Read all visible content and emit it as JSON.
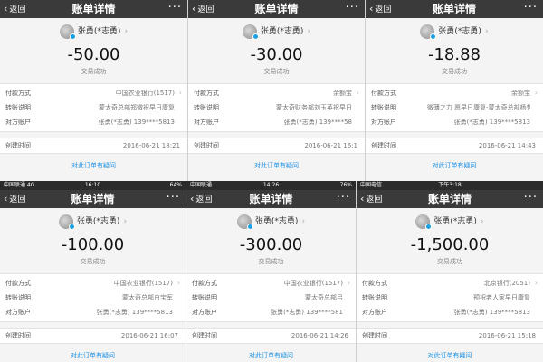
{
  "common": {
    "nav_title": "账单详情",
    "back_label": "返回",
    "more_label": "···",
    "status_label": "交易成功",
    "payment_method_label": "付款方式",
    "transfer_note_label": "转账说明",
    "account_label": "对方账户",
    "created_time_label": "创建时间",
    "question_link": "对此订单有疑问",
    "user_name": "张勇(*志勇)"
  },
  "panels": [
    {
      "amount": "-50.00",
      "payment_method": "中国农业银行(1517)",
      "transfer_note": "蒙太奇总部郑微祝早日康复",
      "account": "张勇(*志勇) 139****5813",
      "created_time": "2016-06-21 18:21"
    },
    {
      "amount": "-30.00",
      "payment_method": "余额宝",
      "transfer_note": "蒙太奇财务部刘玉英祝早日",
      "account": "张勇(*志勇) 139****58",
      "created_time": "2016-06-21 16:1"
    },
    {
      "amount": "-18.88",
      "payment_method": "余额宝",
      "transfer_note": "微薄之力 愿早日康复-蒙太奇总部杨哲",
      "account": "张勇(*志勇) 139****5813",
      "created_time": "2016-06-21 14:43"
    },
    {
      "statusbar": {
        "left": "中国联通 4G",
        "time": "16:10",
        "right": "64%"
      },
      "amount": "-100.00",
      "payment_method": "中国农业银行(1517)",
      "transfer_note": "蒙太奇总部白宝军",
      "account": "张勇(*志勇) 139****5813",
      "created_time": "2016-06-21 16:07"
    },
    {
      "statusbar": {
        "left": "中国联通",
        "time": "14:26",
        "right": "76%"
      },
      "amount": "-300.00",
      "payment_method": "中国农业银行(1517)",
      "transfer_note": "蒙太奇总部吕",
      "account": "张勇(*志勇) 139****581",
      "created_time": "2016-06-21 14:26"
    },
    {
      "statusbar": {
        "left": "中国电信",
        "time": "下午3:18",
        "right": ""
      },
      "amount": "-1,500.00",
      "payment_method": "北京银行(2051)",
      "transfer_note": "预祝老人家早日康复",
      "account": "张勇(*志勇) 139****5813",
      "created_time": "2016-06-21 15:18"
    }
  ]
}
